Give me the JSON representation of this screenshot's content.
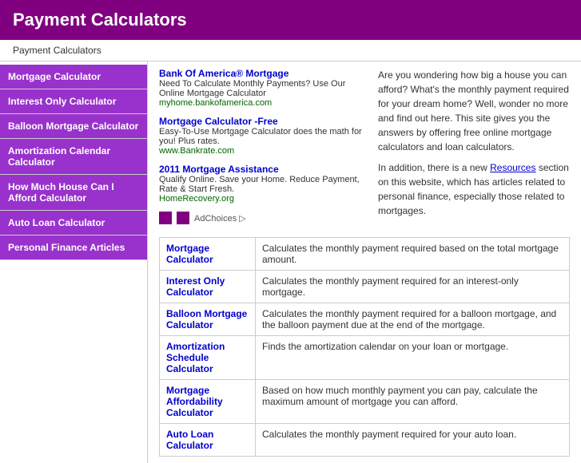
{
  "header": {
    "title": "Payment Calculators"
  },
  "breadcrumb": "Payment Calculators",
  "sidebar": {
    "items": [
      {
        "id": "mortgage-calculator",
        "label": "Mortgage Calculator"
      },
      {
        "id": "interest-only-calculator",
        "label": "Interest Only Calculator"
      },
      {
        "id": "balloon-mortgage-calculator",
        "label": "Balloon Mortgage Calculator"
      },
      {
        "id": "amortization-calendar-calculator",
        "label": "Amortization Calendar Calculator"
      },
      {
        "id": "how-much-house-calculator",
        "label": "How Much House Can I Afford Calculator"
      },
      {
        "id": "auto-loan-calculator",
        "label": "Auto Loan Calculator"
      },
      {
        "id": "personal-finance-articles",
        "label": "Personal Finance Articles"
      }
    ]
  },
  "ads": {
    "items": [
      {
        "title": "Bank Of America® Mortgage",
        "desc": "Need To Calculate Monthly Payments? Use Our Online Mortgage Calculator",
        "url": "myhome.bankofamerica.com"
      },
      {
        "title": "Mortgage Calculator -Free",
        "desc": "Easy-To-Use Mortgage Calculator does the math for you! Plus rates.",
        "url": "www.Bankrate.com"
      },
      {
        "title": "2011 Mortgage Assistance",
        "desc": "Qualify Online. Save your Home. Reduce Payment, Rate & Start Fresh.",
        "url": "HomeRecovery.org"
      }
    ],
    "ad_choices_label": "AdChoices ▷",
    "right_text_1": "Are you wondering how big a house you can afford? What's the monthly payment required for your dream home? Well, wonder no more and find out here. This site gives you the answers by offering free online mortgage calculators and loan calculators.",
    "right_text_2": "In addition, there is a new",
    "right_text_link": "Resources",
    "right_text_3": "section on this website, which has articles related to personal finance, especially those related to mortgages."
  },
  "calc_table": {
    "rows": [
      {
        "name": "Mortgage Calculator",
        "desc": "Calculates the monthly payment required based on the total mortgage amount."
      },
      {
        "name": "Interest Only Calculator",
        "desc": "Calculates the monthly payment required for an interest-only mortgage."
      },
      {
        "name": "Balloon Mortgage Calculator",
        "desc": "Calculates the monthly payment required for a balloon mortgage, and the balloon payment due at the end of the mortgage."
      },
      {
        "name": "Amortization Schedule Calculator",
        "desc": "Finds the amortization calendar on your loan or mortgage."
      },
      {
        "name": "Mortgage Affordability Calculator",
        "desc": "Based on how much monthly payment you can pay, calculate the maximum amount of mortgage you can afford."
      },
      {
        "name": "Auto Loan Calculator",
        "desc": "Calculates the monthly payment required for your auto loan."
      }
    ]
  }
}
